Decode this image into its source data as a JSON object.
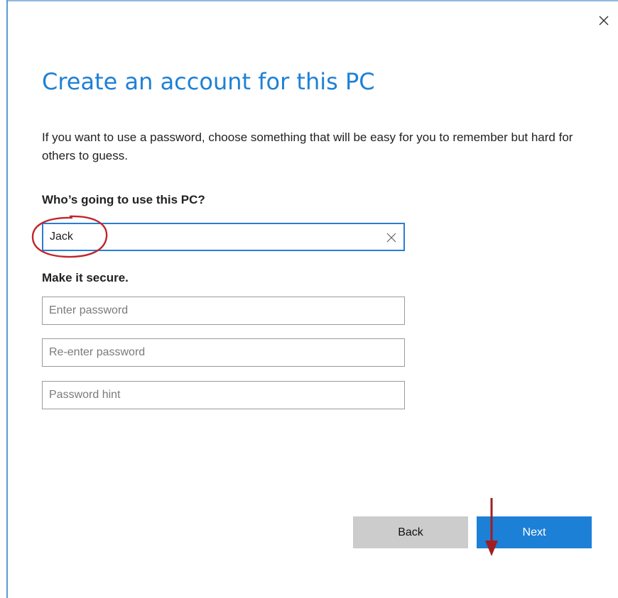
{
  "dialog": {
    "title": "Create an account for this PC",
    "intro": "If you want to use a password, choose something that will be easy for you to remember but hard for others to guess.",
    "close_icon": "close-icon"
  },
  "user": {
    "label": "Who’s going to use this PC?",
    "value": "Jack",
    "clear_icon": "clear-icon"
  },
  "security": {
    "label": "Make it secure.",
    "password_placeholder": "Enter password",
    "reenter_placeholder": "Re-enter password",
    "hint_placeholder": "Password hint"
  },
  "buttons": {
    "back": "Back",
    "next": "Next"
  },
  "annotations": {
    "highlight_color": "#c0262c",
    "arrow_color": "#a01e22"
  },
  "colors": {
    "accent": "#1d80d7",
    "title": "#1e81d6",
    "back_button": "#cccccc"
  }
}
